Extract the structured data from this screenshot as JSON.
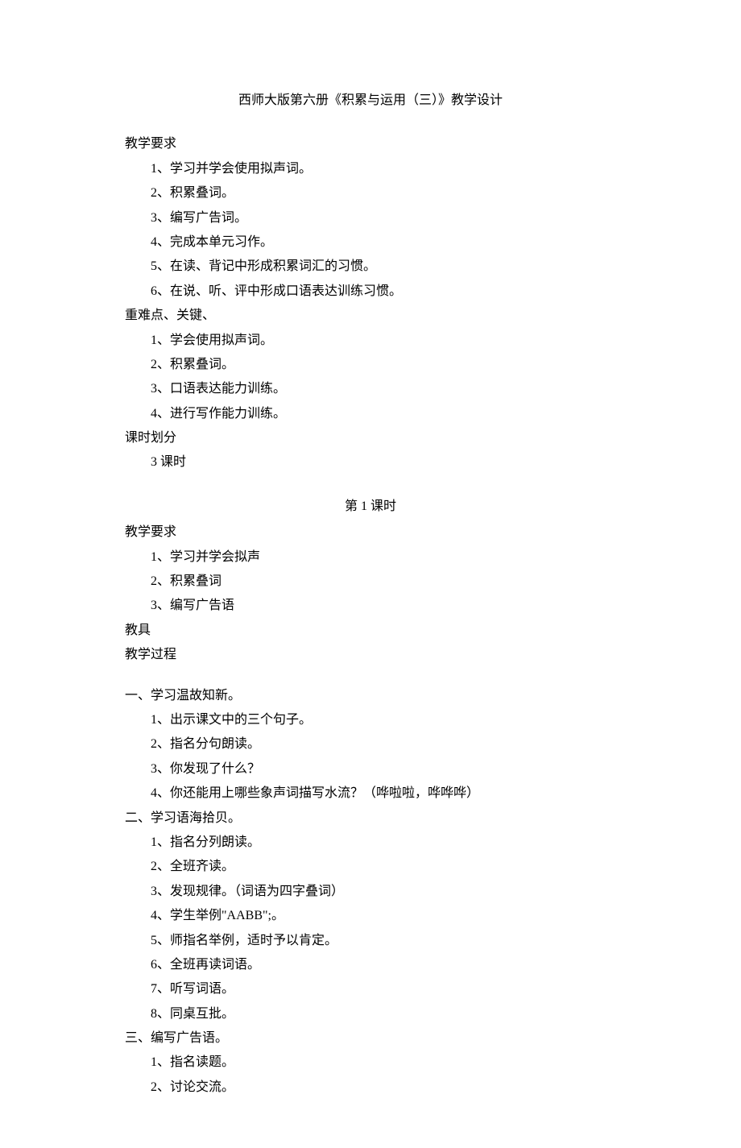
{
  "title": "西师大版第六册《积累与运用（三）》教学设计",
  "sections": [
    {
      "heading": "教学要求",
      "items": [
        "1、学习并学会使用拟声词。",
        "2、积累叠词。",
        "3、编写广告词。",
        "4、完成本单元习作。",
        "5、在读、背记中形成积累词汇的习惯。",
        "6、在说、听、评中形成口语表达训练习惯。"
      ]
    },
    {
      "heading": "重难点、关键、",
      "items": [
        "1、学会使用拟声词。",
        "2、积累叠词。",
        "3、口语表达能力训练。",
        "4、进行写作能力训练。"
      ]
    },
    {
      "heading": "课时划分",
      "items": [
        "3 课时"
      ]
    }
  ],
  "subtitle": "第 1 课时",
  "sections2": [
    {
      "heading": "教学要求",
      "items": [
        "1、学习并学会拟声",
        "2、积累叠词",
        "3、编写广告语"
      ]
    },
    {
      "heading": "教具",
      "items": []
    },
    {
      "heading": "教学过程",
      "items": []
    }
  ],
  "sections3": [
    {
      "heading": "一、学习温故知新。",
      "items": [
        "1、出示课文中的三个句子。",
        "2、指名分句朗读。",
        "3、你发现了什么？",
        "4、你还能用上哪些象声词描写水流？（哗啦啦，哗哗哗）"
      ]
    },
    {
      "heading": "二、学习语海拾贝。",
      "items": [
        "1、指名分列朗读。",
        "2、全班齐读。",
        "3、发现规律。（词语为四字叠词）",
        "4、学生举例\"AABB\";。",
        "5、师指名举例，适时予以肯定。",
        "6、全班再读词语。",
        "7、听写词语。",
        "8、同桌互批。"
      ]
    },
    {
      "heading": "三、编写广告语。",
      "items": [
        "1、指名读题。",
        "2、讨论交流。"
      ]
    }
  ]
}
